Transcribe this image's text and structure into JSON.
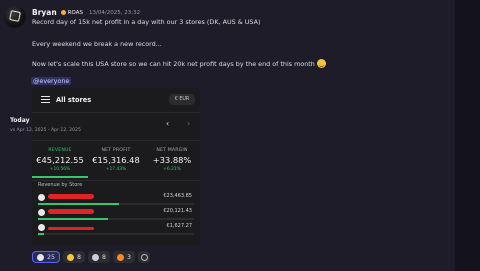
{
  "message": {
    "author": "Bryan",
    "role_badge": "ROAS",
    "timestamp": "13/04/2025, 23:32",
    "lines": [
      "Record day of 15k net profit in a day with our 3 stores (DK, AUS & USA)",
      "Every weekend we break a new record...",
      "Now let's scale this USA store so we can hit 20k net profit days by the end of this month"
    ],
    "mention": "@everyone"
  },
  "dashboard": {
    "title": "All stores",
    "currency": "€ EUR",
    "period_label": "Today",
    "period_compare": "vs Apr 12, 2025 - Apr 12, 2025",
    "nav_prev": "‹",
    "nav_next": "›",
    "metrics": [
      {
        "label": "REVENUE",
        "value": "€45,212.55",
        "change": "+10.56%",
        "active": true
      },
      {
        "label": "NET PROFIT",
        "value": "€15,316.48",
        "change": "+17.43%",
        "active": false
      },
      {
        "label": "NET MARGIN",
        "value": "+33.88%",
        "change": "+6.21%",
        "active": false
      }
    ],
    "section_title": "Revenue by Store",
    "stores": [
      {
        "value": "€23,463.85",
        "share": 0.52
      },
      {
        "value": "€20,121.43",
        "share": 0.45
      },
      {
        "value": "€1,627.27",
        "share": 0.04
      }
    ]
  },
  "reactions": [
    {
      "emoji": "goat-emoji",
      "count": "25",
      "me": true,
      "color": "#e6e6e6"
    },
    {
      "emoji": "heart-eyes-emoji",
      "count": "8",
      "me": false,
      "color": "#f7c43c"
    },
    {
      "emoji": "rocket-emoji",
      "count": "8",
      "me": false,
      "color": "#c8d0dc"
    },
    {
      "emoji": "fire-emoji",
      "count": "3",
      "me": false,
      "color": "#ff8a1f"
    }
  ],
  "colors": {
    "accent_green": "#37c46b",
    "redaction_red": "#e02424",
    "discord_blurple": "#5865f2"
  }
}
